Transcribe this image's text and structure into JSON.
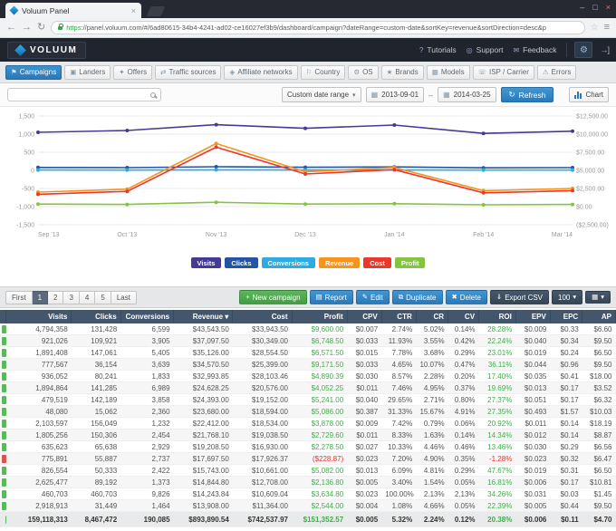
{
  "browser": {
    "tab_title": "Voluum Panel",
    "url_scheme": "https",
    "url_rest": "://panel.voluum.com/#/6ad80615-34b4-4241-ad02-ce16027ef3b9/dashboard/campaign?dateRange=custom-date&sortKey=revenue&sortDirection=desc&p"
  },
  "navbar": {
    "logo_text": "VOLUUM",
    "links": [
      {
        "label": "Tutorials",
        "icon": "question"
      },
      {
        "label": "Support",
        "icon": "lifebuoy"
      },
      {
        "label": "Feedback",
        "icon": "speech"
      }
    ]
  },
  "module_tabs": [
    {
      "label": "Campaigns",
      "icon": "flag",
      "active": true
    },
    {
      "label": "Landers",
      "icon": "monitor",
      "active": false
    },
    {
      "label": "Offers",
      "icon": "tag",
      "active": false
    },
    {
      "label": "Traffic sources",
      "icon": "arrows",
      "active": false
    },
    {
      "label": "Affiliate networks",
      "icon": "network",
      "active": false
    },
    {
      "label": "Country",
      "icon": "flag2",
      "active": false
    },
    {
      "label": "OS",
      "icon": "chip",
      "active": false
    },
    {
      "label": "Brands",
      "icon": "star",
      "active": false
    },
    {
      "label": "Models",
      "icon": "cube",
      "active": false
    },
    {
      "label": "ISP / Carrier",
      "icon": "signal",
      "active": false
    },
    {
      "label": "Errors",
      "icon": "warning",
      "active": false
    }
  ],
  "filters": {
    "search_placeholder": "",
    "date_range": "Custom date range",
    "date_from": "2013-09-01",
    "date_to": "2014-03-25",
    "refresh_label": "Refresh",
    "chart_label": "Chart"
  },
  "chart_data": {
    "type": "line",
    "x": [
      "Sep '13",
      "Oct '13",
      "Nov '13",
      "Dec '13",
      "Jan '14",
      "Feb '14",
      "Mar '14"
    ],
    "left_axis": {
      "min": -1500,
      "max": 1500,
      "ticks": [
        "1,500",
        "1,000",
        "500",
        "0",
        "-500",
        "-1,000",
        "-1,500"
      ]
    },
    "right_axis": {
      "min": -2500,
      "max": 12500,
      "ticks": [
        "$12,500.00",
        "$10,000.00",
        "$7,500.00",
        "$5,000.00",
        "$2,500.00",
        "$0.00",
        "($2,500.00)"
      ]
    },
    "grid": true,
    "legend_position": "bottom",
    "series": [
      {
        "name": "Visits",
        "color": "#453a94",
        "axis": "left",
        "values": [
          1050,
          1100,
          1260,
          1160,
          1250,
          1020,
          1080
        ]
      },
      {
        "name": "Clicks",
        "color": "#2455a4",
        "axis": "left",
        "values": [
          80,
          75,
          100,
          85,
          95,
          70,
          75
        ]
      },
      {
        "name": "Conversions",
        "color": "#2dace3",
        "axis": "left",
        "values": [
          10,
          8,
          15,
          10,
          12,
          8,
          9
        ]
      },
      {
        "name": "Revenue",
        "color": "#f7941e",
        "axis": "right",
        "values": [
          2000,
          2400,
          8700,
          4800,
          5400,
          2200,
          2500
        ]
      },
      {
        "name": "Cost",
        "color": "#e8392b",
        "axis": "right",
        "values": [
          1700,
          2100,
          8200,
          4500,
          5100,
          1900,
          2200
        ]
      },
      {
        "name": "Profit",
        "color": "#85c441",
        "axis": "right",
        "values": [
          350,
          300,
          600,
          350,
          400,
          250,
          300
        ]
      }
    ]
  },
  "pager": {
    "pages": [
      "First",
      "1",
      "2",
      "3",
      "4",
      "5",
      "Last"
    ],
    "active": "1"
  },
  "actions": [
    {
      "label": "New campaign",
      "icon": "plus",
      "style": "green",
      "caret": false
    },
    {
      "label": "Report",
      "icon": "report",
      "style": "blue",
      "caret": false
    },
    {
      "label": "Edit",
      "icon": "pencil",
      "style": "blue",
      "caret": false
    },
    {
      "label": "Duplicate",
      "icon": "copy",
      "style": "blue",
      "caret": false
    },
    {
      "label": "Delete",
      "icon": "trash",
      "style": "blue",
      "caret": false
    },
    {
      "label": "Export CSV",
      "icon": "download",
      "style": "navy",
      "caret": false
    },
    {
      "label": "100",
      "icon": "",
      "style": "navy",
      "caret": true
    },
    {
      "label": "",
      "icon": "grid",
      "style": "navy",
      "caret": true
    }
  ],
  "table": {
    "columns": [
      {
        "label": "Visits",
        "sorted": false
      },
      {
        "label": "Clicks",
        "sorted": false
      },
      {
        "label": "Conversions",
        "sorted": false
      },
      {
        "label": "Revenue",
        "sorted": true
      },
      {
        "label": "Cost",
        "sorted": false
      },
      {
        "label": "Profit",
        "sorted": false
      },
      {
        "label": "CPV",
        "sorted": false
      },
      {
        "label": "CTR",
        "sorted": false
      },
      {
        "label": "CR",
        "sorted": false
      },
      {
        "label": "CV",
        "sorted": false
      },
      {
        "label": "ROI",
        "sorted": false
      },
      {
        "label": "EPV",
        "sorted": false
      },
      {
        "label": "EPC",
        "sorted": false
      },
      {
        "label": "AP",
        "sorted": false
      }
    ],
    "rows": [
      {
        "status": "green",
        "cells": [
          "4,794,358",
          "131,428",
          "6,599",
          "$43,543.50",
          "$33,943.50",
          "$9,600.00",
          "$0.007",
          "2.74%",
          "5.02%",
          "0.14%",
          "28.28%",
          "$0.009",
          "$0.33",
          "$6.60"
        ]
      },
      {
        "status": "green",
        "cells": [
          "921,026",
          "109,921",
          "3,905",
          "$37,097.50",
          "$30,349.00",
          "$6,748.50",
          "$0.033",
          "11.93%",
          "3.55%",
          "0.42%",
          "22.24%",
          "$0.040",
          "$0.34",
          "$9.50"
        ]
      },
      {
        "status": "green",
        "cells": [
          "1,891,408",
          "147,061",
          "5,405",
          "$35,126.00",
          "$28,554.50",
          "$6,571.50",
          "$0.015",
          "7.78%",
          "3.68%",
          "0.29%",
          "23.01%",
          "$0.019",
          "$0.24",
          "$6.50"
        ]
      },
      {
        "status": "green",
        "cells": [
          "777,567",
          "36,154",
          "3,639",
          "$34,570.50",
          "$25,399.00",
          "$9,171.50",
          "$0.033",
          "4.65%",
          "10.07%",
          "0.47%",
          "36.11%",
          "$0.044",
          "$0.96",
          "$9.50"
        ]
      },
      {
        "status": "green",
        "cells": [
          "936,052",
          "80,241",
          "1,833",
          "$32,993.85",
          "$28,103.46",
          "$4,890.39",
          "$0.030",
          "8.57%",
          "2.28%",
          "0.20%",
          "17.40%",
          "$0.035",
          "$0.41",
          "$18.00"
        ]
      },
      {
        "status": "green",
        "cells": [
          "1,894,864",
          "141,285",
          "6,989",
          "$24,628.25",
          "$20,576.00",
          "$4,052.25",
          "$0.011",
          "7.46%",
          "4.95%",
          "0.37%",
          "19.69%",
          "$0.013",
          "$0.17",
          "$3.52"
        ]
      },
      {
        "status": "green",
        "cells": [
          "479,519",
          "142,189",
          "3,858",
          "$24,393.00",
          "$19,152.00",
          "$5,241.00",
          "$0.040",
          "29.65%",
          "2.71%",
          "0.80%",
          "27.37%",
          "$0.051",
          "$0.17",
          "$6.32"
        ]
      },
      {
        "status": "green",
        "cells": [
          "48,080",
          "15,062",
          "2,360",
          "$23,680.00",
          "$18,594.00",
          "$5,086.00",
          "$0.387",
          "31.33%",
          "15.67%",
          "4.91%",
          "27.35%",
          "$0.493",
          "$1.57",
          "$10.03"
        ]
      },
      {
        "status": "green",
        "cells": [
          "2,103,597",
          "156,049",
          "1,232",
          "$22,412.00",
          "$18,534.00",
          "$3,878.00",
          "$0.009",
          "7.42%",
          "0.79%",
          "0.06%",
          "20.92%",
          "$0.011",
          "$0.14",
          "$18.19"
        ]
      },
      {
        "status": "green",
        "cells": [
          "1,805,256",
          "150,306",
          "2,454",
          "$21,768.10",
          "$19,038.50",
          "$2,729.60",
          "$0.011",
          "8.33%",
          "1.63%",
          "0.14%",
          "14.34%",
          "$0.012",
          "$0.14",
          "$8.87"
        ]
      },
      {
        "status": "green",
        "cells": [
          "635,623",
          "65,638",
          "2,929",
          "$19,208.50",
          "$16,930.00",
          "$2,278.50",
          "$0.027",
          "10.33%",
          "4.46%",
          "0.46%",
          "13.46%",
          "$0.030",
          "$0.29",
          "$6.56"
        ]
      },
      {
        "status": "red",
        "cells": [
          "775,891",
          "55,887",
          "2,737",
          "$17,697.50",
          "$17,926.37",
          "($228.87)",
          "$0.023",
          "7.20%",
          "4.90%",
          "0.35%",
          "-1.28%",
          "$0.023",
          "$0.32",
          "$6.47"
        ]
      },
      {
        "status": "green",
        "cells": [
          "826,554",
          "50,333",
          "2,422",
          "$15,743.00",
          "$10,661.00",
          "$5,082.00",
          "$0.013",
          "6.09%",
          "4.81%",
          "0.29%",
          "47.67%",
          "$0.019",
          "$0.31",
          "$6.50"
        ]
      },
      {
        "status": "green",
        "cells": [
          "2,625,477",
          "89,192",
          "1,373",
          "$14,844.80",
          "$12,708.00",
          "$2,136.80",
          "$0.005",
          "3.40%",
          "1.54%",
          "0.05%",
          "16.81%",
          "$0.006",
          "$0.17",
          "$10.81"
        ]
      },
      {
        "status": "green",
        "cells": [
          "460,703",
          "460,703",
          "9,826",
          "$14,243.84",
          "$10,609.04",
          "$3,634.80",
          "$0.023",
          "100.00%",
          "2.13%",
          "2.13%",
          "34.26%",
          "$0.031",
          "$0.03",
          "$1.45"
        ]
      },
      {
        "status": "green",
        "cells": [
          "2,918,913",
          "31,449",
          "1,464",
          "$13,908.00",
          "$11,364.00",
          "$2,544.00",
          "$0.004",
          "1.08%",
          "4.66%",
          "0.05%",
          "22.39%",
          "$0.005",
          "$0.44",
          "$9.50"
        ]
      }
    ],
    "totals": {
      "status": "green",
      "cells": [
        "159,118,313",
        "8,467,472",
        "190,085",
        "$893,890.54",
        "$742,537.97",
        "$151,352.57",
        "$0.005",
        "5.32%",
        "2.24%",
        "0.12%",
        "20.38%",
        "$0.006",
        "$0.11",
        "$4.70"
      ]
    }
  },
  "colors": {
    "accent_blue": "#2b79b9",
    "green": "#5cb85c",
    "red": "#d9534f",
    "header_navy": "#44566b"
  }
}
